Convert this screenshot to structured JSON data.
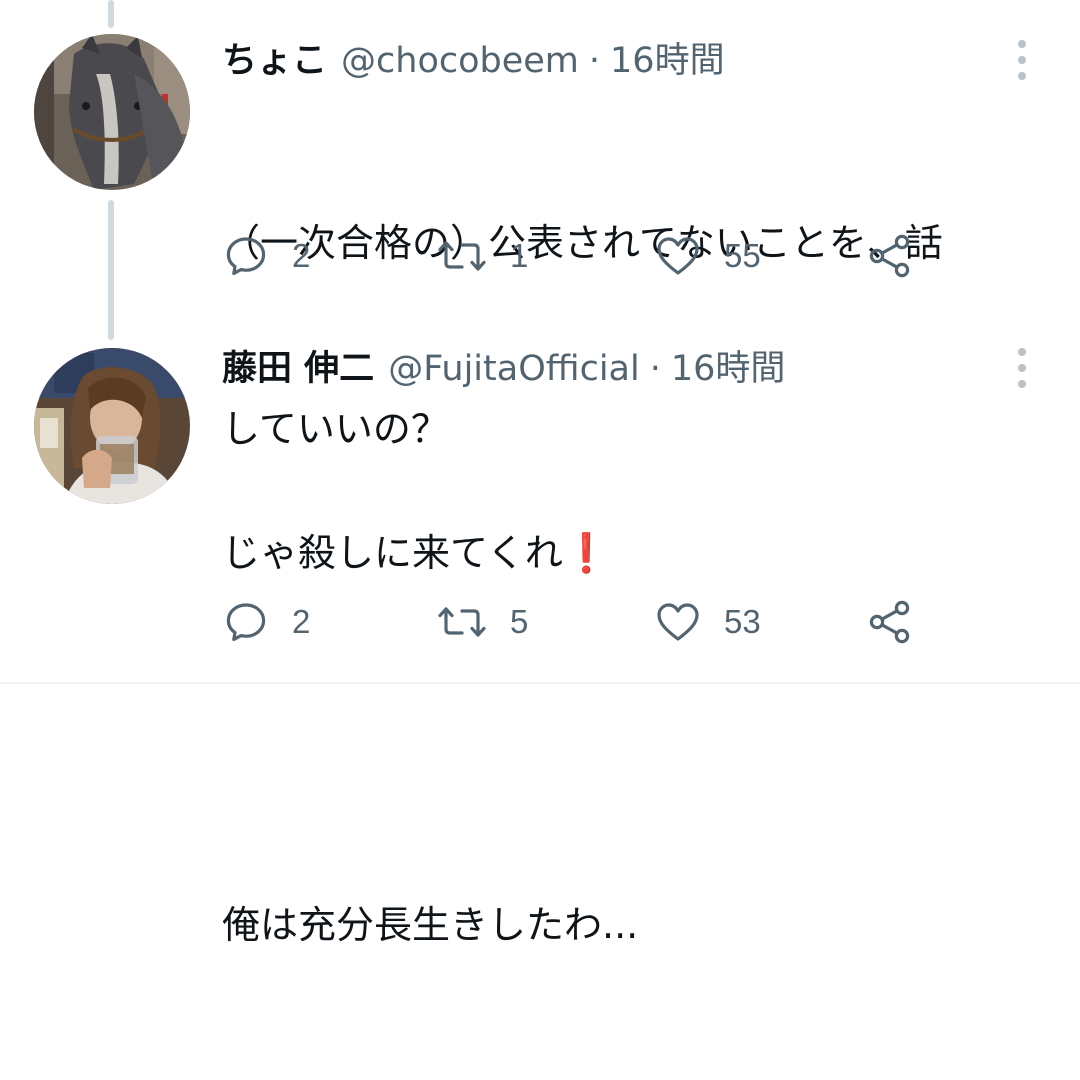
{
  "tweets": [
    {
      "author_name": "ちょこ",
      "handle": "@chocobeem",
      "separator": "·",
      "time": "16時間",
      "text_line1": "（一次合格の）公表されてないことを、話",
      "text_line2": "していいの？",
      "reply_count": "2",
      "retweet_count": "1",
      "like_count": "55",
      "avatar": "horse-photo"
    },
    {
      "author_name": "藤田 伸二",
      "handle": "@FujitaOfficial",
      "separator": "·",
      "time": "16時間",
      "text_line1": "じゃ殺しに来てくれ",
      "text_emoji": "❗",
      "text_line2": "俺は充分長生きしたわ...",
      "reply_count": "2",
      "retweet_count": "5",
      "like_count": "53",
      "avatar": "man-drinking-photo"
    }
  ],
  "icons": {
    "reply": "reply-icon",
    "retweet": "retweet-icon",
    "like": "heart-icon",
    "share": "share-icon",
    "more": "more-options-icon"
  },
  "colors": {
    "text": "#0f1419",
    "secondary": "#536471",
    "icon": "#536471",
    "thread_line": "#cfd9de",
    "exclaim": "#dd2e44"
  }
}
